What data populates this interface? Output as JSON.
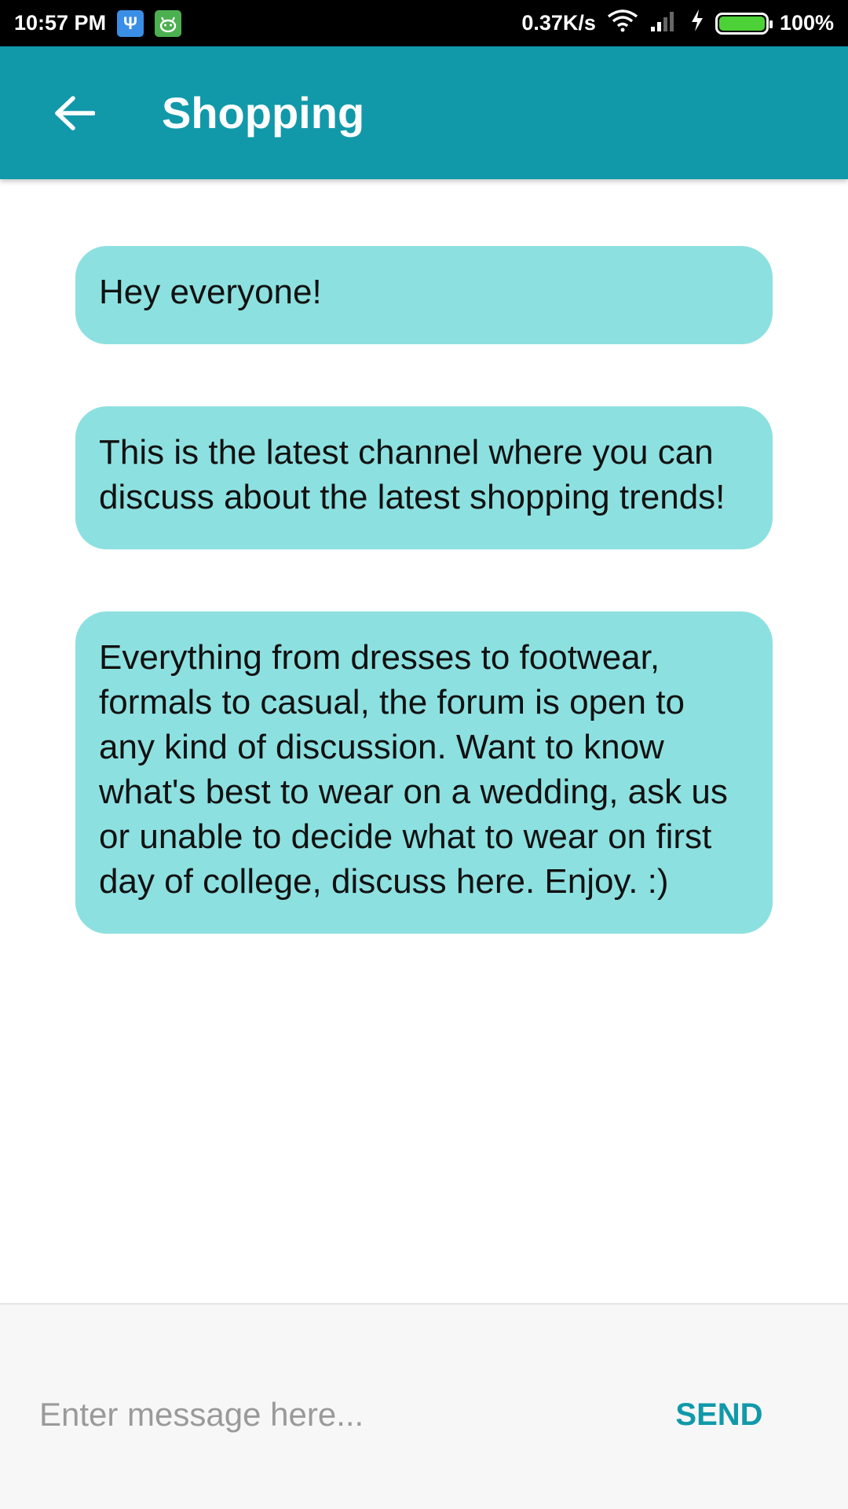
{
  "status_bar": {
    "time": "10:57 PM",
    "network_speed": "0.37K/s",
    "battery": "100%",
    "icons": [
      "usb-icon",
      "android-icon",
      "wifi-icon",
      "signal-icon",
      "charging-icon",
      "battery-icon"
    ]
  },
  "app_bar": {
    "title": "Shopping",
    "back_icon": "arrow-left-icon",
    "color": "#1199aa"
  },
  "messages": [
    {
      "text": "Hey everyone!"
    },
    {
      "text": "This is the latest channel where you can discuss about the latest shopping trends!"
    },
    {
      "text": "Everything from dresses to footwear, formals to casual, the forum is open to any kind of discussion. Want to know what's best to wear on a wedding, ask us or unable to decide what to wear on first day of college, discuss here. Enjoy. :)"
    }
  ],
  "composer": {
    "placeholder": "Enter message here...",
    "value": "",
    "send_label": "SEND"
  },
  "colors": {
    "bubble": "#8de0e0",
    "accent": "#1199aa"
  }
}
